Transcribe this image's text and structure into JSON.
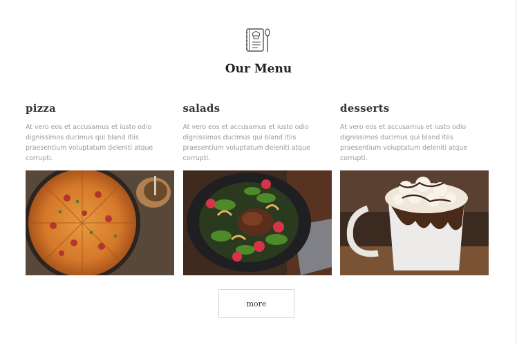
{
  "header": {
    "icon": "menu-book-icon",
    "title": "Our Menu"
  },
  "cards": [
    {
      "title": "pizza",
      "text": "At vero eos et accusamus et iusto odio dignissimos ducimus qui bland itiis praesentium voluptatum deleniti atque corrupti.",
      "image": "pizza-photo"
    },
    {
      "title": "salads",
      "text": "At vero eos et accusamus et iusto odio dignissimos ducimus qui bland itiis praesentium voluptatum deleniti atque corrupti.",
      "image": "salad-photo"
    },
    {
      "title": "desserts",
      "text": "At vero eos et accusamus et iusto odio dignissimos ducimus qui bland itiis praesentium voluptatum deleniti atque corrupti.",
      "image": "dessert-photo"
    }
  ],
  "more_button": {
    "label": "more"
  }
}
